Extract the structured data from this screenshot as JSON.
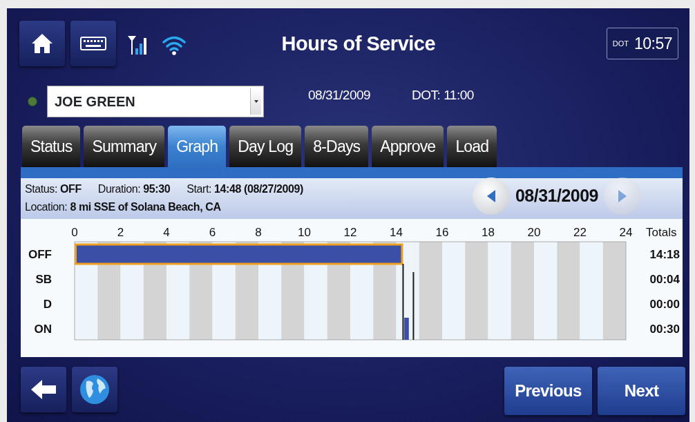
{
  "header": {
    "title": "Hours of Service",
    "clock_label": "DOT",
    "clock_time": "10:57"
  },
  "driver": {
    "name": "JOE GREEN",
    "date": "08/31/2009",
    "dot_time": "DOT: 11:00"
  },
  "tabs": [
    {
      "label": "Status",
      "selected": false
    },
    {
      "label": "Summary",
      "selected": false
    },
    {
      "label": "Graph",
      "selected": true
    },
    {
      "label": "Day Log",
      "selected": false
    },
    {
      "label": "8-Days",
      "selected": false
    },
    {
      "label": "Approve",
      "selected": false
    },
    {
      "label": "Load",
      "selected": false
    }
  ],
  "info": {
    "line_1": [
      "Status: **OFF**",
      "Duration: **95:30**",
      "Start: **14:48 (08/27/2009)**"
    ],
    "line_2": "Location: **8 mi SSE of Solana Beach, CA**"
  },
  "date_nav": {
    "date": "08/31/2009",
    "prev_disabled": false,
    "next_disabled": true
  },
  "graph": {
    "hour_labels": [
      "0",
      "2",
      "4",
      "6",
      "8",
      "10",
      "12",
      "14",
      "16",
      "18",
      "20",
      "22",
      "24"
    ],
    "totals_heading": "Totals",
    "rows": [
      {
        "label": "OFF",
        "total": "14:18"
      },
      {
        "label": "SB",
        "total": "00:04"
      },
      {
        "label": "D",
        "total": "00:00"
      },
      {
        "label": "ON",
        "total": "00:30"
      }
    ]
  },
  "footer": {
    "buttons": [
      "Previous",
      "Next"
    ]
  }
}
